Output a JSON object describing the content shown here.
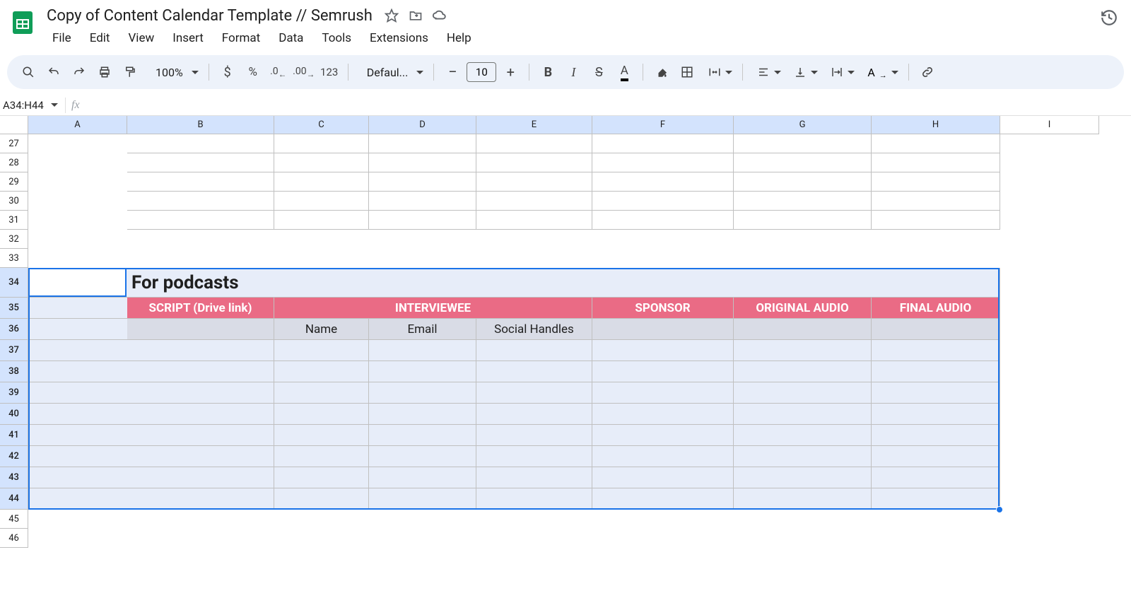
{
  "doc": {
    "title": "Copy of Content Calendar Template // Semrush"
  },
  "menu": {
    "file": "File",
    "edit": "Edit",
    "view": "View",
    "insert": "Insert",
    "format": "Format",
    "data": "Data",
    "tools": "Tools",
    "extensions": "Extensions",
    "help": "Help"
  },
  "toolbar": {
    "zoom": "100%",
    "font": "Defaul...",
    "fontsize": "10"
  },
  "namebox": {
    "value": "A34:H44"
  },
  "columns": [
    "A",
    "B",
    "C",
    "D",
    "E",
    "F",
    "G",
    "H",
    "I"
  ],
  "rows_visible": [
    "27",
    "28",
    "29",
    "30",
    "31",
    "32",
    "33",
    "34",
    "35",
    "36",
    "37",
    "38",
    "39",
    "40",
    "41",
    "42",
    "43",
    "44",
    "45",
    "46"
  ],
  "podcast": {
    "title": "For podcasts",
    "headers": {
      "script": "SCRIPT (Drive link)",
      "interviewee": "INTERVIEWEE",
      "sponsor": "SPONSOR",
      "original_audio": "ORIGINAL AUDIO",
      "final_audio": "FINAL AUDIO"
    },
    "subheaders": {
      "name": "Name",
      "email": "Email",
      "social": "Social Handles"
    }
  }
}
